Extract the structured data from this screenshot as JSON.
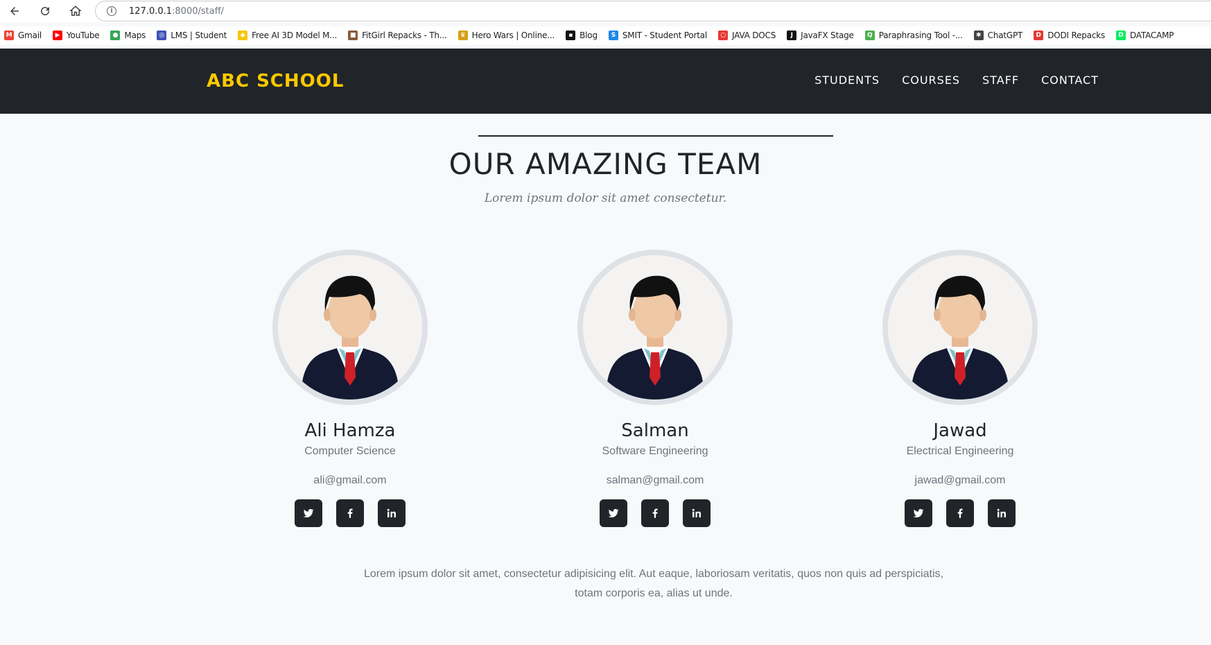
{
  "browser": {
    "url_host": "127.0.0.1",
    "url_path": ":8000/staff/",
    "bookmarks": [
      {
        "label": "Gmail",
        "icon": "gmail-icon",
        "color": "#ea4335",
        "glyph": "M"
      },
      {
        "label": "YouTube",
        "icon": "youtube-icon",
        "color": "#ff0000",
        "glyph": "▶"
      },
      {
        "label": "Maps",
        "icon": "maps-icon",
        "color": "#34a853",
        "glyph": "●"
      },
      {
        "label": "LMS | Student",
        "icon": "lms-icon",
        "color": "#3f51b5",
        "glyph": "◎"
      },
      {
        "label": "Free AI 3D Model M...",
        "icon": "meshy-icon",
        "color": "#f7c600",
        "glyph": "◆"
      },
      {
        "label": "FitGirl Repacks - Th...",
        "icon": "fitgirl-icon",
        "color": "#8b5a3c",
        "glyph": "■"
      },
      {
        "label": "Hero Wars | Online...",
        "icon": "herowars-icon",
        "color": "#d4a017",
        "glyph": "♛"
      },
      {
        "label": "Blog",
        "icon": "blog-icon",
        "color": "#111111",
        "glyph": "▪"
      },
      {
        "label": "SMIT - Student Portal",
        "icon": "smit-icon",
        "color": "#1e88e5",
        "glyph": "S"
      },
      {
        "label": "JAVA DOCS",
        "icon": "oracle-icon",
        "color": "#e53935",
        "glyph": "○"
      },
      {
        "label": "JavaFX Stage",
        "icon": "javafx-icon",
        "color": "#111111",
        "glyph": "J"
      },
      {
        "label": "Paraphrasing Tool -...",
        "icon": "quillbot-icon",
        "color": "#4caf50",
        "glyph": "Q"
      },
      {
        "label": "ChatGPT",
        "icon": "chatgpt-icon",
        "color": "#444444",
        "glyph": "✱"
      },
      {
        "label": "DODI Repacks",
        "icon": "dodi-icon",
        "color": "#e53935",
        "glyph": "D"
      },
      {
        "label": "DATACAMP",
        "icon": "datacamp-icon",
        "color": "#03ef62",
        "glyph": "D"
      }
    ]
  },
  "header": {
    "brand": "ABC SCHOOL",
    "brand_color": "#ffc800",
    "menu": [
      "STUDENTS",
      "COURSES",
      "STAFF",
      "CONTACT"
    ]
  },
  "team": {
    "title": "OUR AMAZING TEAM",
    "subtitle": "Lorem ipsum dolor sit amet consectetur.",
    "members": [
      {
        "name": "Ali Hamza",
        "dept": "Computer Science",
        "email": "ali@gmail.com"
      },
      {
        "name": "Salman",
        "dept": "Software Engineering",
        "email": "salman@gmail.com"
      },
      {
        "name": "Jawad",
        "dept": "Electrical Engineering",
        "email": "jawad@gmail.com"
      }
    ],
    "social_icons": [
      "twitter-icon",
      "facebook-icon",
      "linkedin-icon"
    ],
    "footer": "Lorem ipsum dolor sit amet, consectetur adipisicing elit. Aut eaque, laboriosam veritatis, quos non quis ad perspiciatis, totam corporis ea, alias ut unde."
  }
}
